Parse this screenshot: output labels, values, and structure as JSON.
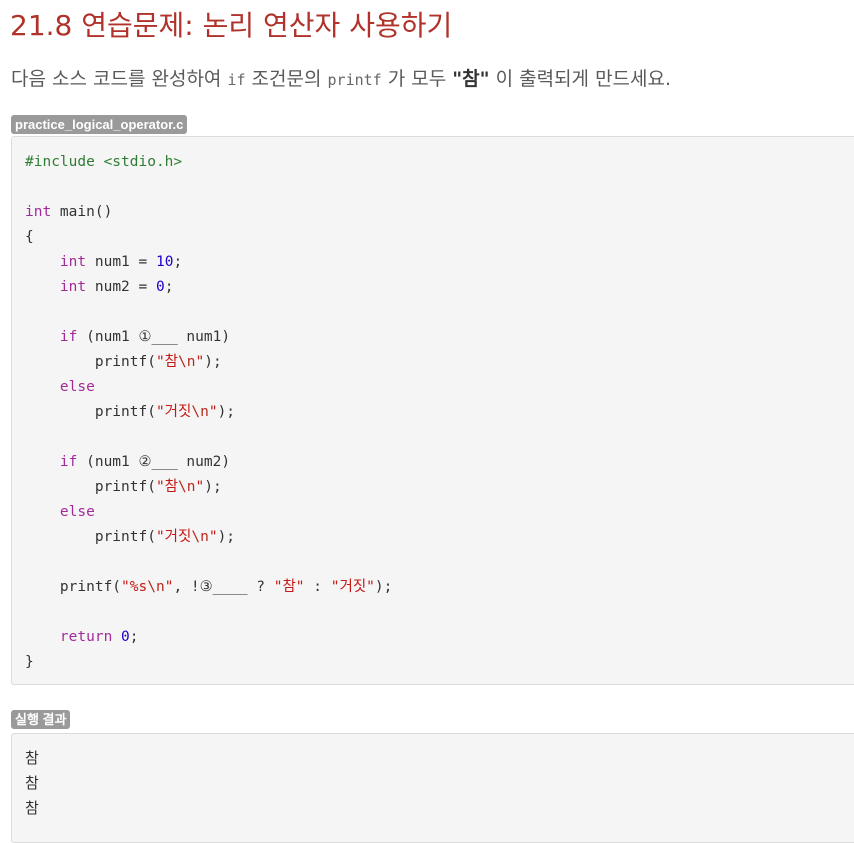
{
  "title": "21.8 연습문제: 논리 연산자 사용하기",
  "intro": {
    "part1": "다음 소스 코드를 완성하여 ",
    "code1": "if",
    "part2": " 조건문의 ",
    "code2": "printf",
    "part3": " 가 모두 ",
    "strong": "\"참\"",
    "part4": " 이 출력되게 만드세요."
  },
  "code_file": {
    "filename": "practice_logical_operator.c",
    "lines": [
      [
        [
          "inc",
          "#include "
        ],
        [
          "inc2",
          "<stdio.h>"
        ]
      ],
      [],
      [
        [
          "type",
          "int"
        ],
        [
          "",
          " main()"
        ]
      ],
      [
        [
          "",
          "{"
        ]
      ],
      [
        [
          "",
          "    "
        ],
        [
          "type",
          "int"
        ],
        [
          "",
          " num1 = "
        ],
        [
          "num",
          "10"
        ],
        [
          "",
          ";"
        ]
      ],
      [
        [
          "",
          "    "
        ],
        [
          "type",
          "int"
        ],
        [
          "",
          " num2 = "
        ],
        [
          "num",
          "0"
        ],
        [
          "",
          ";"
        ]
      ],
      [],
      [
        [
          "",
          "    "
        ],
        [
          "ctrl",
          "if"
        ],
        [
          "",
          " (num1 ①___ num1)"
        ]
      ],
      [
        [
          "",
          "        printf("
        ],
        [
          "str",
          "\"참"
        ],
        [
          "esc",
          "\\n"
        ],
        [
          "str",
          "\""
        ],
        [
          "",
          ");"
        ]
      ],
      [
        [
          "",
          "    "
        ],
        [
          "ctrl",
          "else"
        ]
      ],
      [
        [
          "",
          "        printf("
        ],
        [
          "str",
          "\"거짓"
        ],
        [
          "esc",
          "\\n"
        ],
        [
          "str",
          "\""
        ],
        [
          "",
          ");"
        ]
      ],
      [],
      [
        [
          "",
          "    "
        ],
        [
          "ctrl",
          "if"
        ],
        [
          "",
          " (num1 ②___ num2)"
        ]
      ],
      [
        [
          "",
          "        printf("
        ],
        [
          "str",
          "\"참"
        ],
        [
          "esc",
          "\\n"
        ],
        [
          "str",
          "\""
        ],
        [
          "",
          ");"
        ]
      ],
      [
        [
          "",
          "    "
        ],
        [
          "ctrl",
          "else"
        ]
      ],
      [
        [
          "",
          "        printf("
        ],
        [
          "str",
          "\"거짓"
        ],
        [
          "esc",
          "\\n"
        ],
        [
          "str",
          "\""
        ],
        [
          "",
          ");"
        ]
      ],
      [],
      [
        [
          "",
          "    printf("
        ],
        [
          "str",
          "\"%s"
        ],
        [
          "esc",
          "\\n"
        ],
        [
          "str",
          "\""
        ],
        [
          "",
          ", !③____ ? "
        ],
        [
          "str",
          "\"참\""
        ],
        [
          "",
          " : "
        ],
        [
          "str",
          "\"거짓\""
        ],
        [
          "",
          ");"
        ]
      ],
      [],
      [
        [
          "",
          "    "
        ],
        [
          "ctrl",
          "return"
        ],
        [
          "",
          " "
        ],
        [
          "num",
          "0"
        ],
        [
          "",
          ";"
        ]
      ],
      [
        [
          "",
          "}"
        ]
      ]
    ]
  },
  "result": {
    "label": "실행 결과",
    "lines": [
      "참",
      "참",
      "참"
    ]
  }
}
